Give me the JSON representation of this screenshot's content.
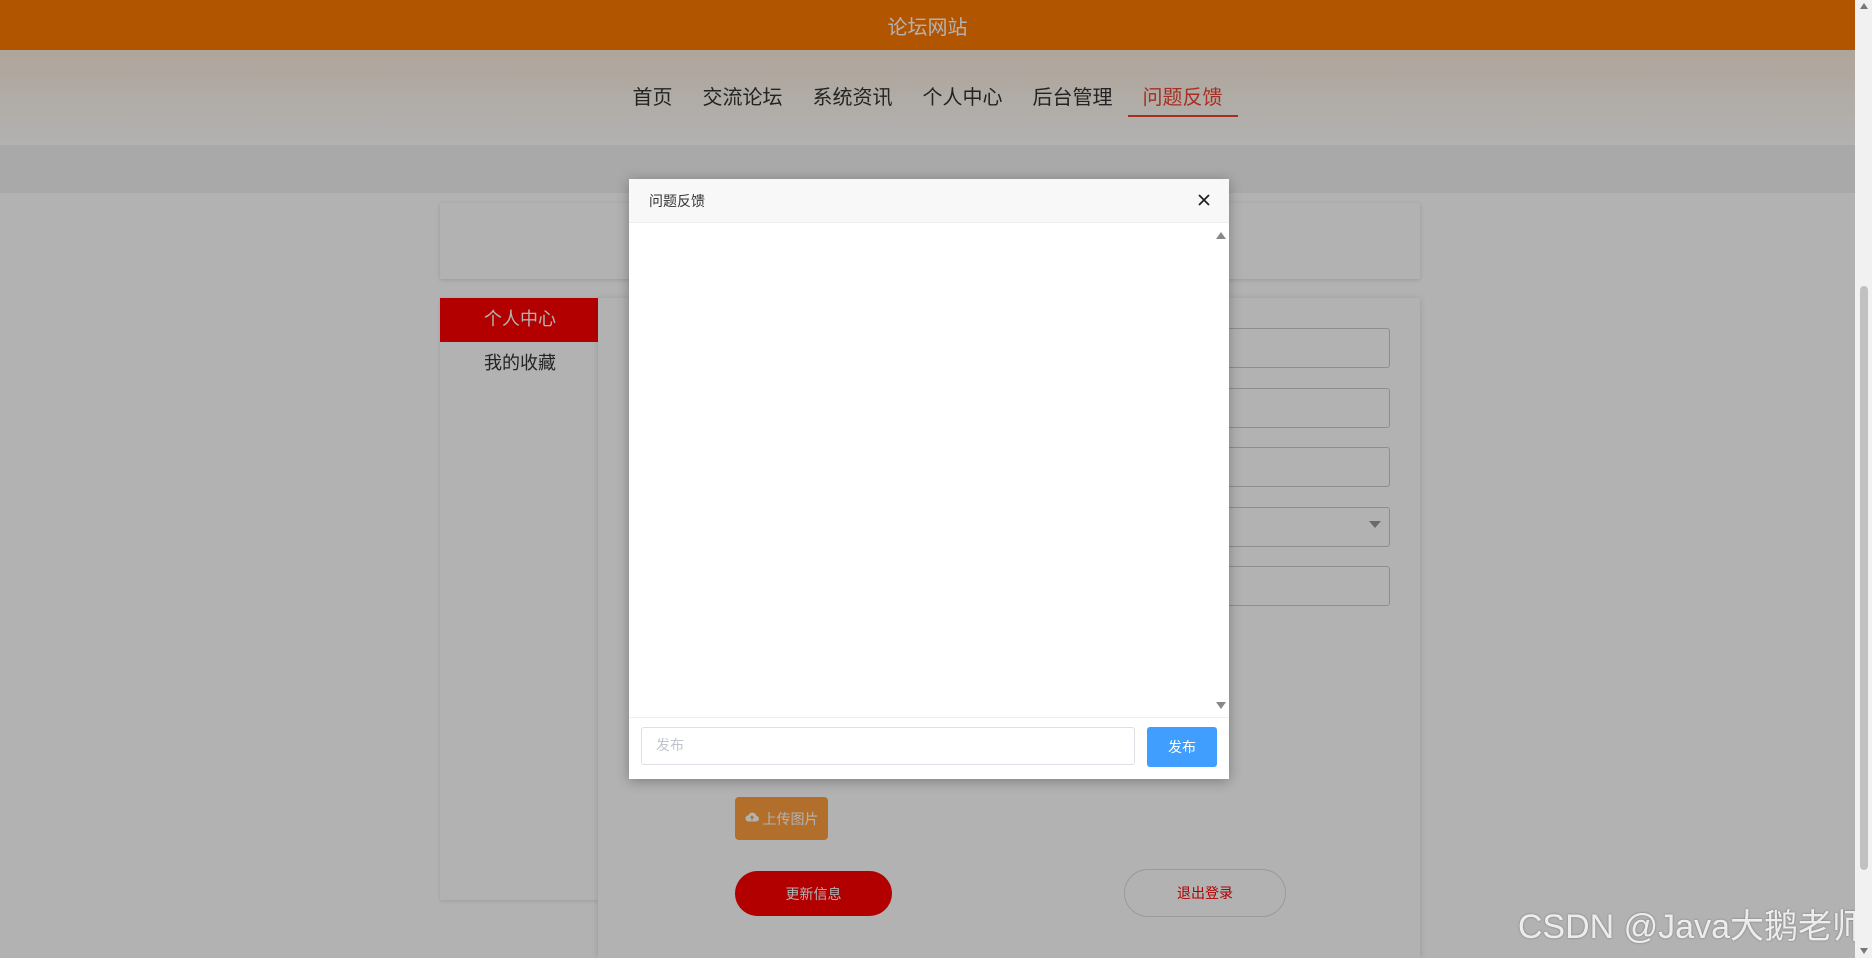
{
  "site": {
    "title": "论坛网站"
  },
  "nav": {
    "items": [
      "首页",
      "交流论坛",
      "系统资讯",
      "个人中心",
      "后台管理",
      "问题反馈"
    ],
    "active": "问题反馈"
  },
  "sidebar": {
    "items": [
      "个人中心",
      "我的收藏"
    ]
  },
  "form": {
    "upload_label": "上传图片",
    "update_label": "更新信息",
    "logout_label": "退出登录"
  },
  "modal": {
    "title": "问题反馈",
    "input_placeholder": "发布",
    "send_label": "发布"
  },
  "watermark": "CSDN @Java大鹅老师",
  "colors": {
    "brand": "#ff7a00",
    "active_nav": "#e43",
    "primary_red": "#ff0000",
    "send_blue": "#409eff",
    "upload_orange": "#ffa040"
  }
}
